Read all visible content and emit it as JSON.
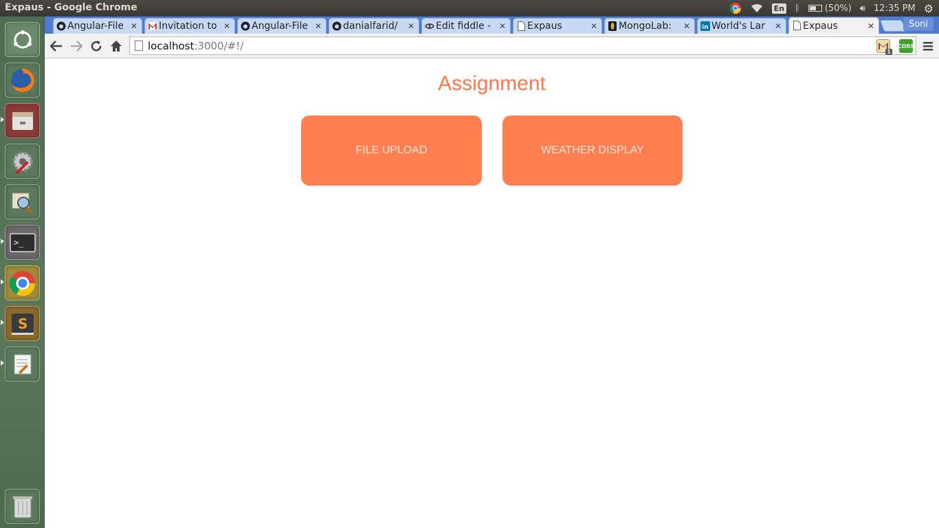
{
  "window": {
    "title": "Expaus - Google Chrome"
  },
  "indicators": {
    "lang": "En",
    "battery": "(50%)",
    "time": "12:35 PM"
  },
  "launcher": {
    "items": [
      {
        "name": "ubuntu-dash-icon",
        "glyph": "◎",
        "bg": "#5f7f5f"
      },
      {
        "name": "firefox-icon",
        "glyph": "●",
        "bg": "#5f7f5f"
      },
      {
        "name": "files-icon",
        "glyph": "▭",
        "bg": "#8a3c3c"
      },
      {
        "name": "system-settings-icon",
        "glyph": "⚙",
        "bg": "#5f7f5f"
      },
      {
        "name": "image-viewer-icon",
        "glyph": "⌕",
        "bg": "#5f7f5f"
      },
      {
        "name": "terminal-icon",
        "glyph": ">_",
        "bg": "#5f7f5f"
      },
      {
        "name": "chrome-icon",
        "glyph": "◉",
        "bg": "#9a8a3c"
      },
      {
        "name": "sublime-text-icon",
        "glyph": "S",
        "bg": "#8a6a2c"
      },
      {
        "name": "text-editor-icon",
        "glyph": "✎",
        "bg": "#5f7f5f"
      }
    ],
    "trash": "trash-icon"
  },
  "tabs": [
    {
      "title": "Angular-File",
      "favicon": "github-icon"
    },
    {
      "title": "Invitation to",
      "favicon": "gmail-icon"
    },
    {
      "title": "Angular-File",
      "favicon": "github-icon"
    },
    {
      "title": "danialfarid/",
      "favicon": "github-icon"
    },
    {
      "title": "Edit fiddle -",
      "favicon": "jsfiddle-icon"
    },
    {
      "title": "Expaus",
      "favicon": "page-icon"
    },
    {
      "title": "MongoLab:",
      "favicon": "mongolab-icon"
    },
    {
      "title": "World's Lar",
      "favicon": "linkedin-icon"
    },
    {
      "title": "Expaus",
      "favicon": "page-icon",
      "active": true
    }
  ],
  "profile": "Soni",
  "omnibox": {
    "host": "localhost",
    "rest": ":3000/#!/"
  },
  "extensions": {
    "cors_label": "CORS",
    "gmail_badge": "1"
  },
  "page": {
    "title": "Assignment",
    "buttons": {
      "file_upload": "FILE UPLOAD",
      "weather_display": "WEATHER DISPLAY"
    }
  },
  "colors": {
    "accent": "#ff7f50",
    "title": "#fe774a",
    "button_text": "#fde6de"
  }
}
